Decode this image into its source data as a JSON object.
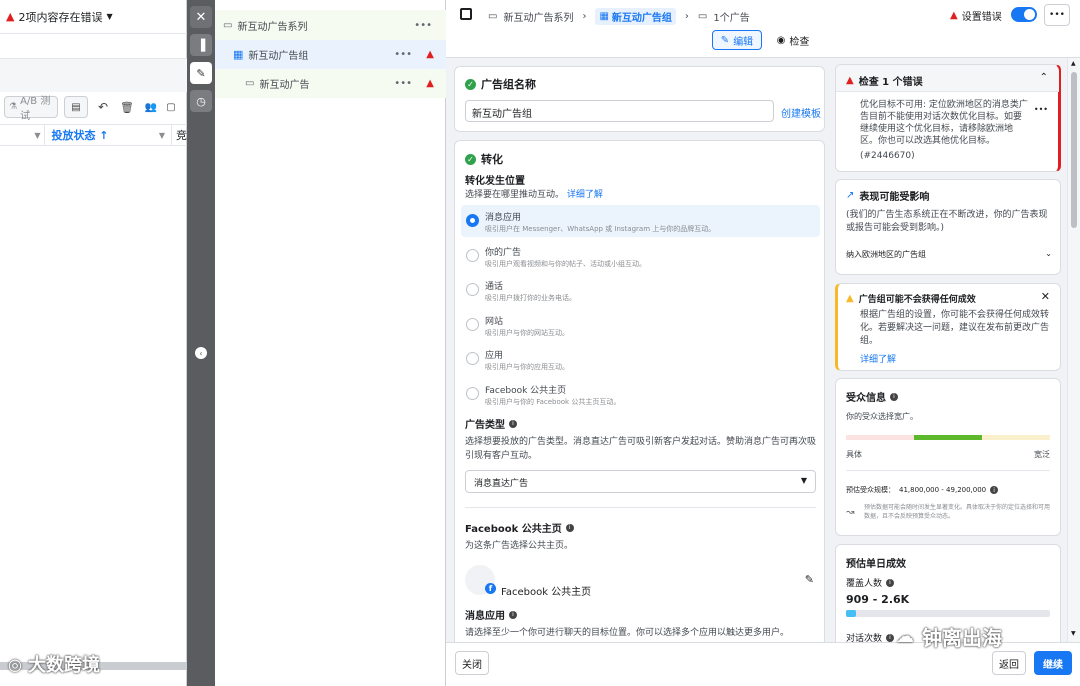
{
  "left_pane": {
    "error_text": "2项内容存在错误",
    "ab_test_label": "A/B 测试",
    "column_delivery_status": "投放状态 ↑",
    "column_cut": "竞"
  },
  "tree": {
    "campaign": "新互动广告系列",
    "adset": "新互动广告组",
    "ad": "新互动广告"
  },
  "topbar": {
    "breadcrumb": [
      "新互动广告系列",
      "新互动广告组",
      "1个广告"
    ],
    "setup_errors_label": "设置错误",
    "tab_edit": "编辑",
    "tab_review": "检查",
    "more": "•••"
  },
  "form": {
    "adset_name": {
      "section_title": "广告组名称",
      "value": "新互动广告组",
      "create_template": "创建模板"
    },
    "conversion": {
      "section_title": "转化",
      "location_label": "转化发生位置",
      "location_help": "选择要在哪里推动互动。",
      "learn_more": "详细了解",
      "options": [
        {
          "title": "消息应用",
          "sub": "吸引用户在 Messenger、WhatsApp 或 Instagram 上与你的品牌互动。",
          "selected": true
        },
        {
          "title": "你的广告",
          "sub": "吸引用户观看视频和与你的帖子、活动或小组互动。",
          "selected": false
        },
        {
          "title": "通话",
          "sub": "吸引用户拨打你的业务电话。",
          "selected": false
        },
        {
          "title": "网站",
          "sub": "吸引用户与你的网站互动。",
          "selected": false
        },
        {
          "title": "应用",
          "sub": "吸引用户与你的应用互动。",
          "selected": false
        },
        {
          "title": "Facebook 公共主页",
          "sub": "吸引用户与你的 Facebook 公共主页互动。",
          "selected": false
        }
      ],
      "ad_type_label": "广告类型",
      "ad_type_help": "选择想要投放的广告类型。消息直达广告可吸引新客户发起对话。赞助消息广告可再次吸引现有客户互动。",
      "ad_type_value": "消息直达广告",
      "fb_page_label": "Facebook 公共主页",
      "fb_page_help": "为这条广告选择公共主页。",
      "fb_page_value": "Facebook 公共主页",
      "messaging_apps_label": "消息应用",
      "messaging_apps_help": "请选择至少一个你可进行聊天的目标位置。你可以选择多个应用以触达更多用户。"
    }
  },
  "right": {
    "errors": {
      "title": "检查 1 个错误",
      "body": "优化目标不可用: 定位欧洲地区的消息类广告目前不能使用对话次数优化目标。如要继续使用这个优化目标，请移除欧洲地区。你也可以改选其他优化目标。",
      "code": "(#2446670)"
    },
    "performance": {
      "title": "表现可能受影响",
      "body": "(我们的广告生态系统正在不断改进，你的广告表现或报告可能会受到影响。)",
      "row": "纳入欧洲地区的广告组"
    },
    "no_results": {
      "title": "广告组可能不会获得任何成效",
      "body": "根据广告组的设置，你可能不会获得任何成效转化。若要解决这一问题，建议在发布前更改广告组。",
      "link": "详细了解"
    },
    "audience": {
      "title": "受众信息",
      "desc": "你的受众选择宽广。",
      "left_label": "具体",
      "right_label": "宽泛",
      "size_label": "预估受众规模：",
      "size_value": "41,800,000 - 49,200,000",
      "note": "预估数据可能会随时间发生显著变化。具体取决于你的定位选择和可用数据，且不会反映预算受众动态。",
      "breadth_level": 0.5
    },
    "daily": {
      "title": "预估单日成效",
      "reach_label": "覆盖人数",
      "reach_value": "909 - 2.6K",
      "reach_level": 0.05,
      "conversations_label": "对话次数"
    }
  },
  "footer": {
    "close": "关闭",
    "back": "返回",
    "continue": "继续"
  },
  "watermarks": {
    "left": "大数跨境",
    "right": "钟离出海"
  },
  "colors": {
    "accent": "#1877f2",
    "error": "#e02020",
    "warning": "#f7b928",
    "success": "#31a24c"
  }
}
